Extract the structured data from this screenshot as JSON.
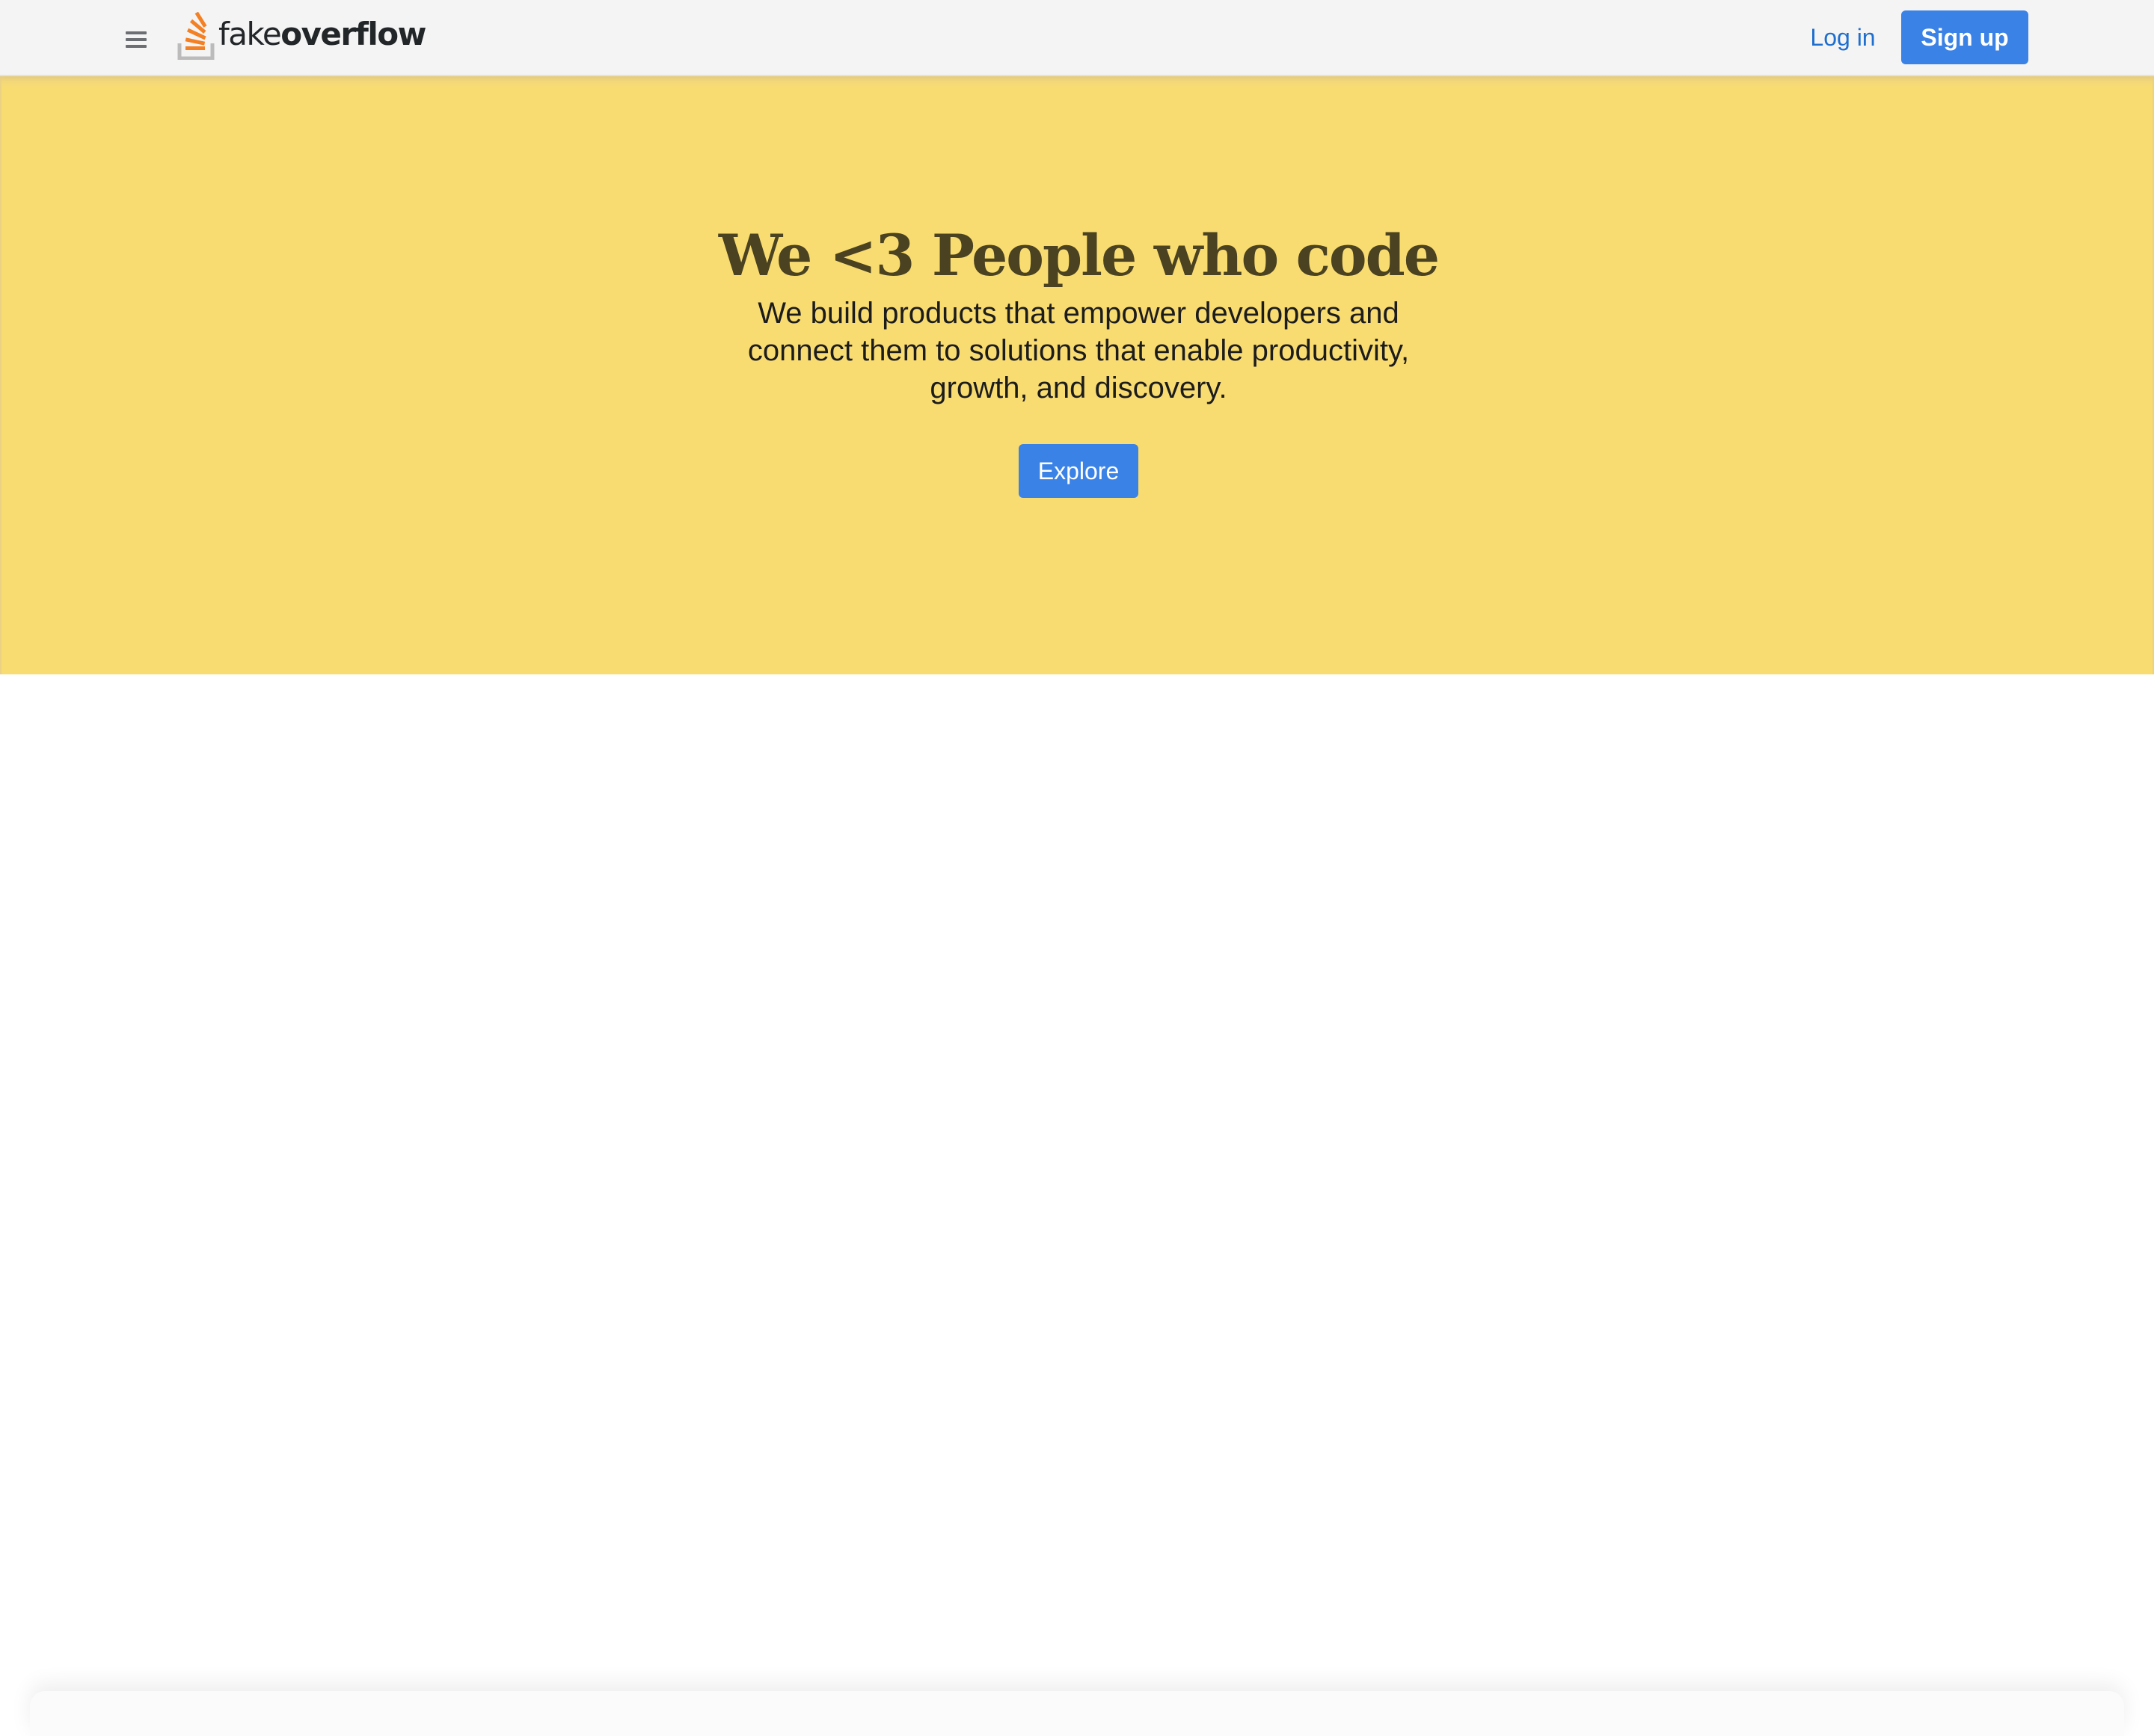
{
  "header": {
    "menu_icon": "hamburger-menu-icon",
    "logo": {
      "icon": "stack-logo-icon",
      "text_light": "fake",
      "text_bold": "overflow",
      "colors": {
        "orange": "#f48024",
        "gray": "#bcbbbb"
      }
    },
    "login_label": "Log in",
    "signup_label": "Sign up"
  },
  "hero": {
    "title": "We <3 People who code",
    "subtitle": "We build products that empower developers and connect them to solutions that enable productivity, growth, and discovery.",
    "cta_label": "Explore"
  },
  "colors": {
    "hero_background": "#f9dc71",
    "hero_title": "#4a4220",
    "primary_button": "#3b82e6",
    "link": "#1f6fcf",
    "header_background": "#f4f4f4"
  }
}
